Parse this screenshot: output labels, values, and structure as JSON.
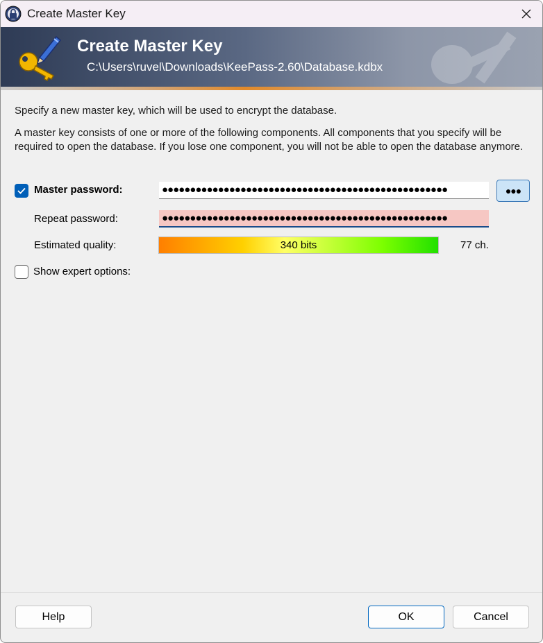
{
  "window": {
    "title": "Create Master Key"
  },
  "banner": {
    "title": "Create Master Key",
    "path": "C:\\Users\\ruvel\\Downloads\\KeePass-2.60\\Database.kdbx"
  },
  "intro": {
    "line1": "Specify a new master key, which will be used to encrypt the database.",
    "line2": "A master key consists of one or more of the following components. All components that you specify will be required to open the database. If you lose one component, you will not be able to open the database anymore."
  },
  "master_password": {
    "label": "Master password:",
    "checked": true,
    "value_masked": "●●●●●●●●●●●●●●●●●●●●●●●●●●●●●●●●●●●●●●●●●●●●●●●●●●●",
    "reveal_label": "●●●"
  },
  "repeat_password": {
    "label": "Repeat password:",
    "value_masked": "●●●●●●●●●●●●●●●●●●●●●●●●●●●●●●●●●●●●●●●●●●●●●●●●●●●"
  },
  "quality": {
    "label": "Estimated quality:",
    "bits_text": "340 bits",
    "chars_text": "77 ch."
  },
  "expert_options": {
    "label": "Show expert options:",
    "checked": false
  },
  "buttons": {
    "help": "Help",
    "ok": "OK",
    "cancel": "Cancel"
  },
  "colors": {
    "accent": "#005fb8",
    "repeat_mismatch_bg": "#f6c7c3"
  },
  "icons": {
    "app": "keepass-lock-icon",
    "banner": "key-pen-icon",
    "close": "close-icon",
    "check": "checkmark-icon"
  }
}
